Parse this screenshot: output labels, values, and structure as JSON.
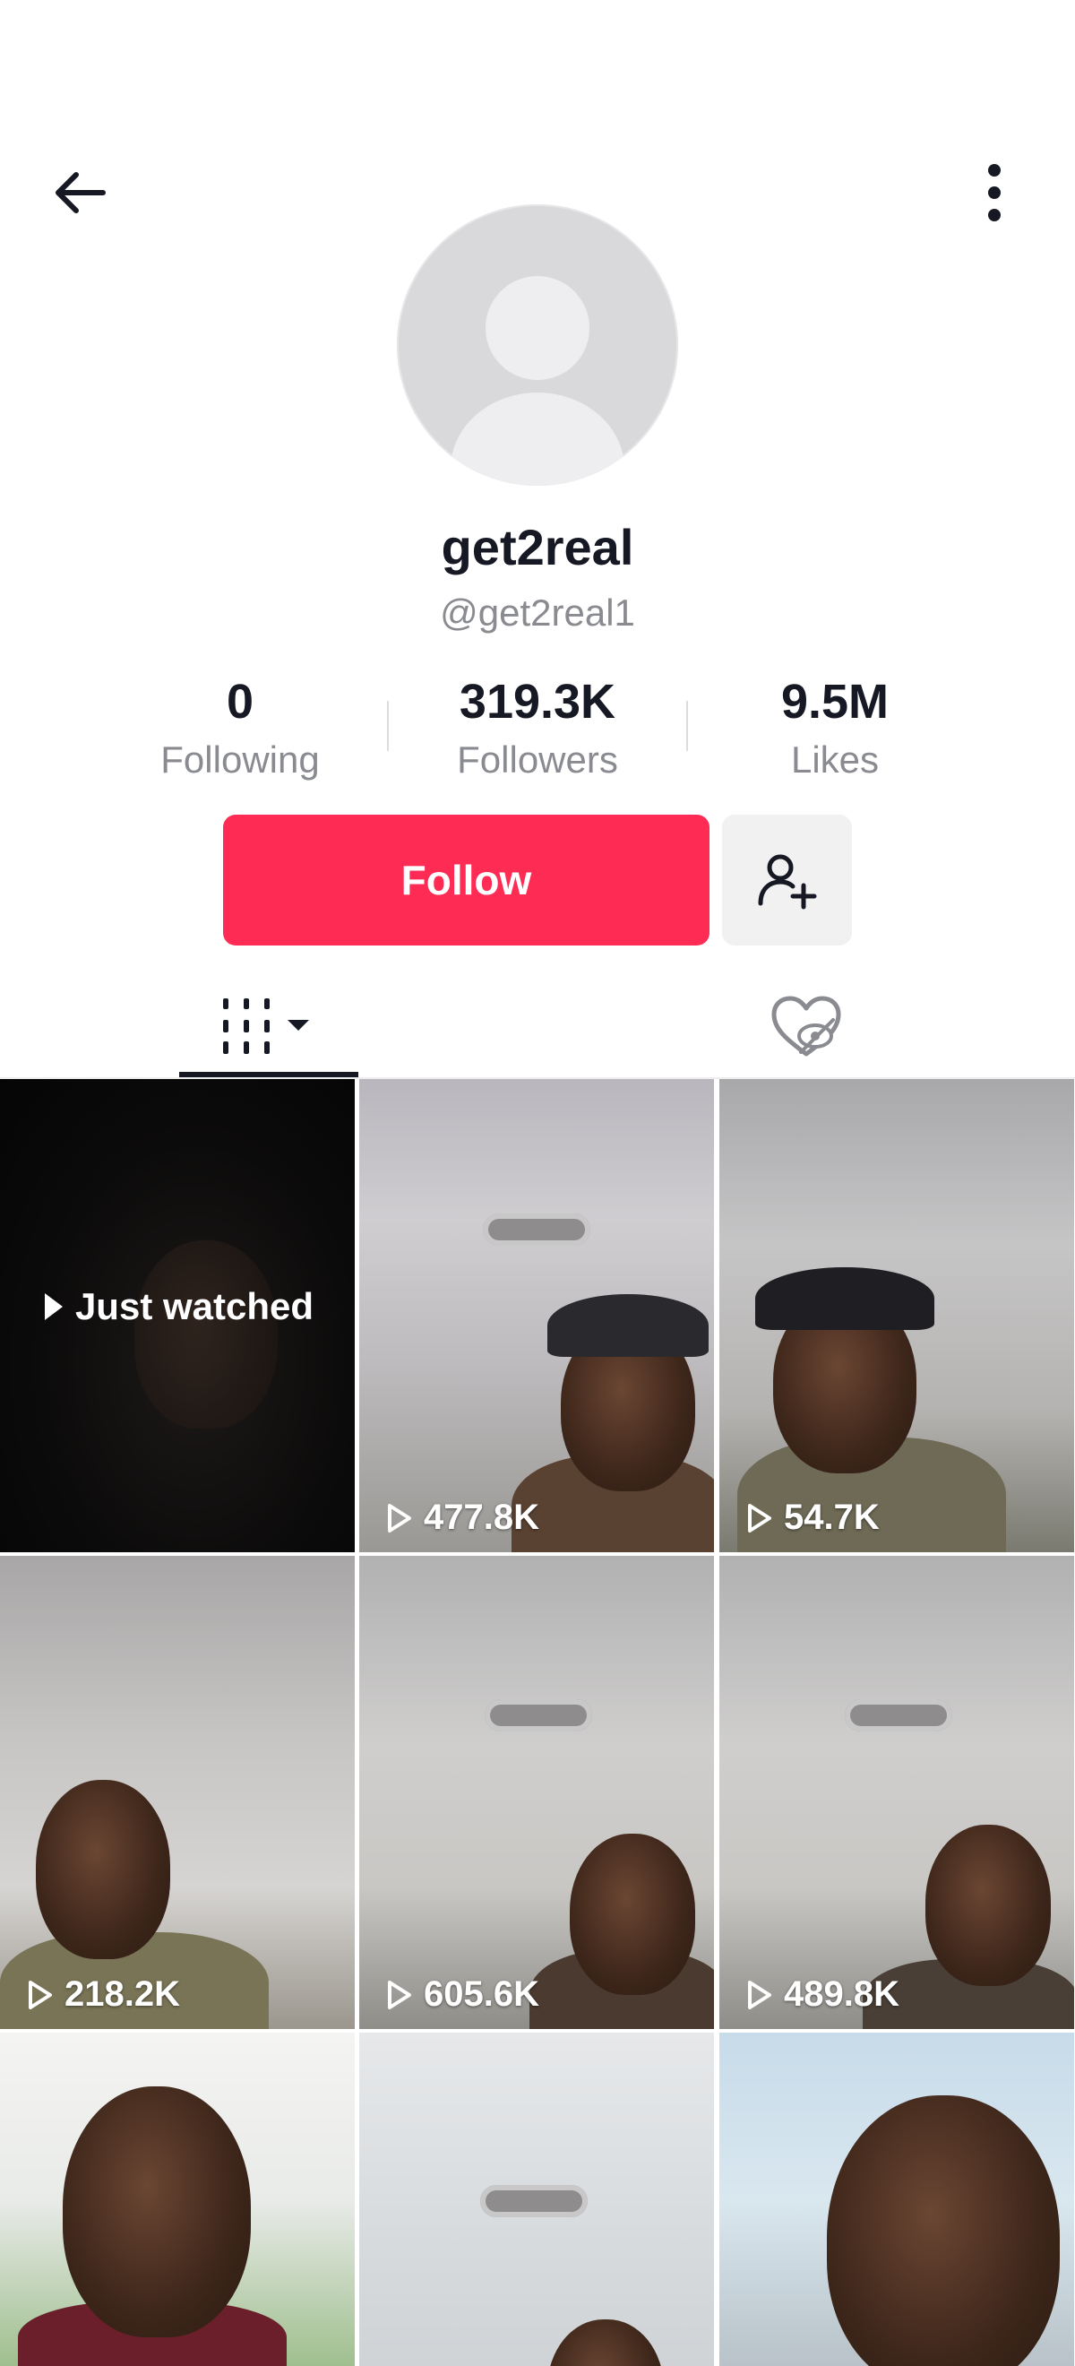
{
  "header": {
    "back_icon": "arrow-left-icon",
    "more_icon": "more-vertical-icon"
  },
  "profile": {
    "avatar_icon": "default-avatar-icon",
    "display_name": "get2real",
    "handle": "@get2real1"
  },
  "stats": [
    {
      "value": "0",
      "label": "Following"
    },
    {
      "value": "319.3K",
      "label": "Followers"
    },
    {
      "value": "9.5M",
      "label": "Likes"
    }
  ],
  "actions": {
    "follow_label": "Follow",
    "follow_color": "#fe2c55",
    "add_friend_icon": "add-user-icon"
  },
  "tabs": {
    "videos_icon": "grid-icon",
    "liked_icon": "liked-hidden-icon"
  },
  "videos": [
    {
      "label": "Just watched",
      "type": "just-watched"
    },
    {
      "views": "477.8K"
    },
    {
      "views": "54.7K"
    },
    {
      "views": "218.2K"
    },
    {
      "views": "605.6K"
    },
    {
      "views": "489.8K"
    },
    {
      "views": ""
    },
    {
      "views": ""
    },
    {
      "views": ""
    }
  ]
}
